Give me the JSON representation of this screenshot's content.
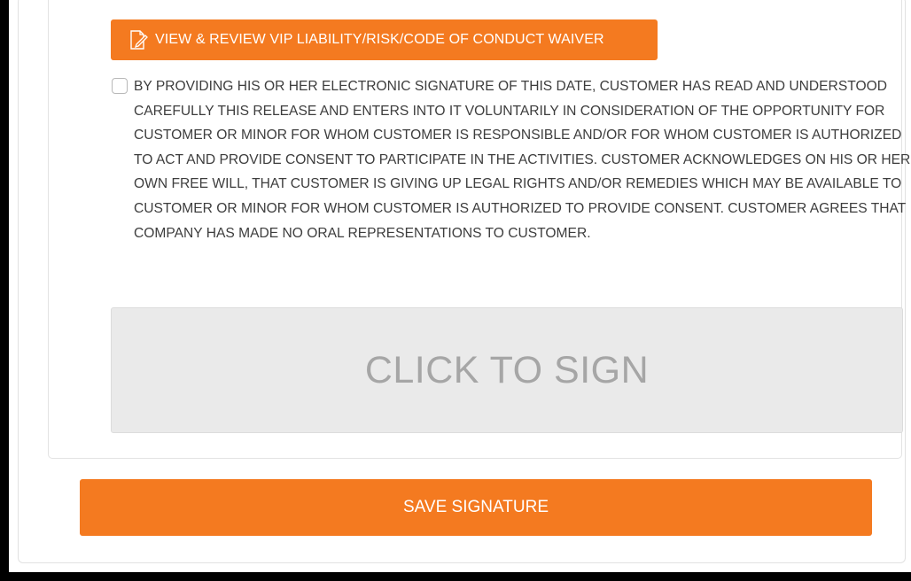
{
  "waiver": {
    "view_button_label": "VIEW & REVIEW VIP LIABILITY/RISK/CODE OF CONDUCT WAIVER",
    "view_button_icon": "document-edit-icon",
    "consent_checked": false,
    "consent_text": "BY PROVIDING HIS OR HER ELECTRONIC SIGNATURE OF THIS DATE, CUSTOMER HAS READ AND UNDERSTOOD CAREFULLY THIS RELEASE AND ENTERS INTO IT VOLUNTARILY IN CONSIDERATION OF THE OPPORTUNITY FOR CUSTOMER OR MINOR FOR WHOM CUSTOMER IS RESPONSIBLE AND/OR FOR WHOM CUSTOMER IS AUTHORIZED TO ACT AND PROVIDE CONSENT TO PARTICIPATE IN THE ACTIVITIES. CUSTOMER ACKNOWLEDGES ON HIS OR HER OWN FREE WILL, THAT CUSTOMER IS GIVING UP LEGAL RIGHTS AND/OR REMEDIES WHICH MAY BE AVAILABLE TO CUSTOMER OR MINOR FOR WHOM CUSTOMER IS AUTHORIZED TO PROVIDE CONSENT. CUSTOMER AGREES THAT COMPANY HAS MADE NO ORAL REPRESENTATIONS TO CUSTOMER.",
    "sign_prompt": "CLICK TO SIGN",
    "save_button_label": "SAVE SIGNATURE"
  },
  "colors": {
    "accent": "#f47a20",
    "sign_area_bg": "#eaeaea",
    "text": "#3d3d3d"
  }
}
